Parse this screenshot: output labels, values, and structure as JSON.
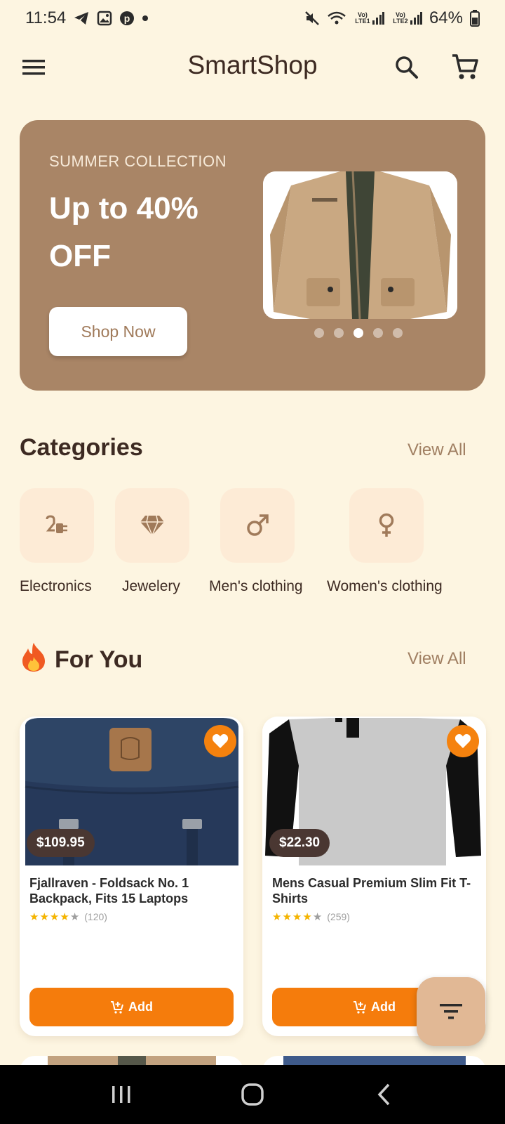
{
  "status_bar": {
    "time": "11:54",
    "lte1": "Vo) LTE1",
    "lte2": "Vo) LTE2",
    "battery": "64%"
  },
  "app_bar": {
    "title": "SmartShop"
  },
  "banner": {
    "kicker": "SUMMER COLLECTION",
    "headline": "Up to 40% OFF",
    "cta": "Shop Now",
    "slides": 5,
    "active_slide": 3
  },
  "categories": {
    "title": "Categories",
    "view_all": "View All",
    "items": [
      {
        "label": "Electronics",
        "icon": "power-plug-icon"
      },
      {
        "label": "Jewelery",
        "icon": "diamond-icon"
      },
      {
        "label": "Men's clothing",
        "icon": "male-symbol-icon"
      },
      {
        "label": "Women's clothing",
        "icon": "female-symbol-icon"
      }
    ]
  },
  "for_you": {
    "emoji": "🔥",
    "title": "For You",
    "view_all": "View All",
    "products": [
      {
        "title": "Fjallraven - Foldsack No. 1 Backpack, Fits 15 Laptops",
        "price": "$109.95",
        "stars": 4,
        "rating_count": "(120)",
        "add_label": "Add"
      },
      {
        "title": "Mens Casual Premium Slim Fit T-Shirts",
        "price": "$22.30",
        "stars": 4,
        "rating_count": "(259)",
        "add_label": "Add"
      }
    ]
  },
  "colors": {
    "background": "#fdf5e1",
    "banner": "#a98566",
    "accent": "#f57c0c",
    "price_badge": "#4a3732",
    "fab": "#e1b895"
  }
}
